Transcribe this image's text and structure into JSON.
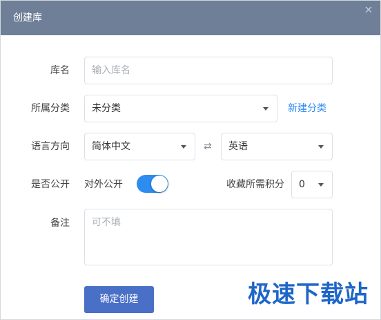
{
  "dialog": {
    "title": "创建库",
    "close_symbol": "×",
    "close_icon": "close-icon"
  },
  "form": {
    "name": {
      "label": "库名",
      "placeholder": "输入库名",
      "value": ""
    },
    "category": {
      "label": "所属分类",
      "value": "未分类",
      "new_link": "新建分类"
    },
    "language": {
      "label": "语言方向",
      "source": "简体中文",
      "swap_symbol": "⇄",
      "target": "英语"
    },
    "public": {
      "label": "是否公开",
      "toggle_label": "对外公开",
      "enabled": true,
      "points_label": "收藏所需积分",
      "points_value": "0"
    },
    "note": {
      "label": "备注",
      "placeholder": "可不填"
    }
  },
  "actions": {
    "confirm": "确定创建"
  },
  "watermark": "极速下载站",
  "colors": {
    "header": "#6f7f98",
    "accent": "#2d8cf0",
    "button": "#4a6fc7"
  }
}
